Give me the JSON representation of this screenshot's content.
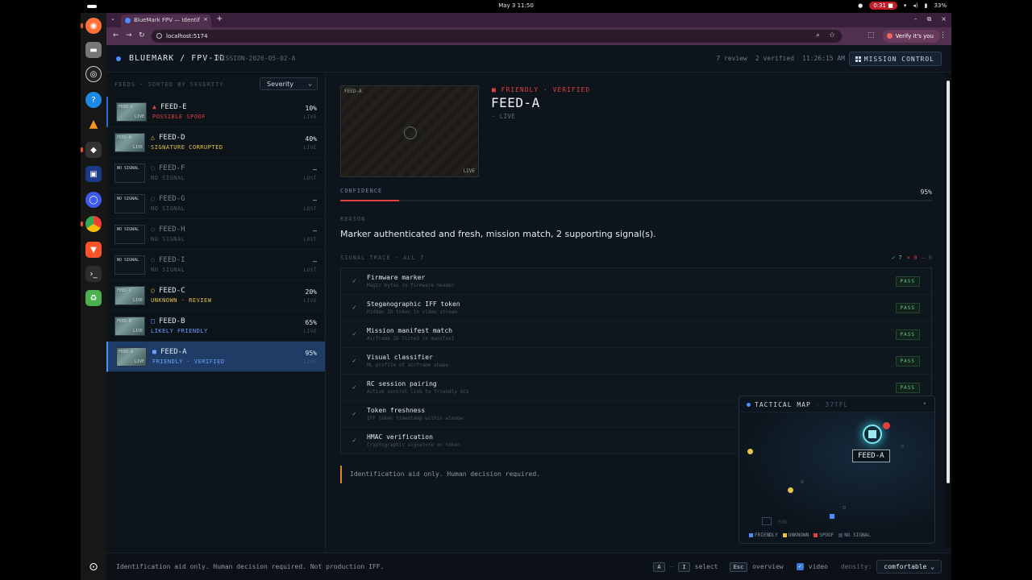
{
  "system": {
    "clock": "May 3  11:50",
    "record_time": "0:31",
    "battery": "33%"
  },
  "browser": {
    "tab_title": "BlueMark FPV — Identif",
    "url": "localhost:5174",
    "verify_label": "Verify it's you"
  },
  "header": {
    "brand": "BLUEMARK / FPV-ID",
    "mission": "MISSION-2026-05-02-A",
    "review": "7 review",
    "verified": "2 verified",
    "time": "11:26:15 AM",
    "mission_control": "MISSION CONTROL"
  },
  "sidebar": {
    "label": "FEEDS · SORTED BY SEVERITY",
    "sort_value": "Severity",
    "feeds": [
      {
        "name": "FEED-E",
        "icon": "▲",
        "icon_color": "#e0413f",
        "status": "POSSIBLE SPOOF",
        "status_color": "#e0413f",
        "pct": "10%",
        "state": "LIVE",
        "live": true,
        "thumb_tl": "FEED-E",
        "thumb_br": "LIVE"
      },
      {
        "name": "FEED-D",
        "icon": "△",
        "icon_color": "#e6c34a",
        "status": "SIGNATURE CORRUPTED",
        "status_color": "#e6c34a",
        "pct": "40%",
        "state": "LIVE",
        "live": true,
        "thumb_tl": "FEED-D",
        "thumb_br": "LIVE"
      },
      {
        "name": "FEED-F",
        "icon": "○",
        "icon_color": "#4a5866",
        "status": "NO SIGNAL",
        "status_color": "#4a5866",
        "pct": "—",
        "state": "LOST",
        "live": false,
        "thumb_tl": "NO SIGNAL",
        "thumb_br": ""
      },
      {
        "name": "FEED-G",
        "icon": "○",
        "icon_color": "#4a5866",
        "status": "NO SIGNAL",
        "status_color": "#4a5866",
        "pct": "—",
        "state": "LOST",
        "live": false,
        "thumb_tl": "NO SIGNAL",
        "thumb_br": ""
      },
      {
        "name": "FEED-H",
        "icon": "○",
        "icon_color": "#4a5866",
        "status": "NO SIGNAL",
        "status_color": "#4a5866",
        "pct": "—",
        "state": "LOST",
        "live": false,
        "thumb_tl": "NO SIGNAL",
        "thumb_br": ""
      },
      {
        "name": "FEED-I",
        "icon": "○",
        "icon_color": "#4a5866",
        "status": "NO SIGNAL",
        "status_color": "#4a5866",
        "pct": "—",
        "state": "LOST",
        "live": false,
        "thumb_tl": "NO SIGNAL",
        "thumb_br": ""
      },
      {
        "name": "FEED-C",
        "icon": "○",
        "icon_color": "#e6c34a",
        "status": "UNKNOWN · REVIEW",
        "status_color": "#e6c34a",
        "pct": "20%",
        "state": "LIVE",
        "live": true,
        "thumb_tl": "FEED-C",
        "thumb_br": "LIVE"
      },
      {
        "name": "FEED-B",
        "icon": "□",
        "icon_color": "#6ea0ff",
        "status": "LIKELY FRIENDLY",
        "status_color": "#6ea0ff",
        "pct": "65%",
        "state": "LIVE",
        "live": true,
        "thumb_tl": "FEED-B",
        "thumb_br": "LIVE"
      },
      {
        "name": "FEED-A",
        "icon": "■",
        "icon_color": "#6ea0ff",
        "status": "FRIENDLY · VERIFIED",
        "status_color": "#6ea0ff",
        "pct": "95%",
        "state": "LIVE",
        "live": true,
        "thumb_tl": "FEED-A",
        "thumb_br": "LIVE"
      }
    ]
  },
  "detail": {
    "video_label": "FEED-A",
    "video_state": "LIVE",
    "badge": "FRIENDLY · VERIFIED",
    "title": "FEED-A",
    "subtitle": "· LIVE",
    "confidence_label": "CONFIDENCE",
    "confidence_value": "95%",
    "confidence_fraction": 0.1,
    "reason_label": "REASON",
    "reason": "Marker authenticated and fresh, mission match, 2 supporting signal(s).",
    "trace_label": "SIGNAL TRACE · ALL 7",
    "counts": {
      "pass": "✓ 7",
      "fail": "× 0",
      "other": "– 0"
    },
    "trace": [
      {
        "name": "Firmware marker",
        "desc": "Magic bytes in firmware header",
        "result": "PASS"
      },
      {
        "name": "Steganographic IFF token",
        "desc": "Hidden ID token in video stream",
        "result": "PASS"
      },
      {
        "name": "Mission manifest match",
        "desc": "Airframe ID listed in manifest",
        "result": "PASS"
      },
      {
        "name": "Visual classifier",
        "desc": "ML profile of airframe shape",
        "result": "PASS"
      },
      {
        "name": "RC session pairing",
        "desc": "Active control link to friendly GCS",
        "result": "PASS"
      },
      {
        "name": "Token freshness",
        "desc": "IFF token timestamp within window",
        "result": ""
      },
      {
        "name": "HMAC verification",
        "desc": "Cryptographic signature on token",
        "result": ""
      }
    ],
    "note": "Identification aid only. Human decision required."
  },
  "map": {
    "title": "TACTICAL MAP",
    "subtitle": "· 37TFL",
    "selected_label": "FEED-A",
    "fob_label": "FOB",
    "legend": [
      {
        "label": "FRIENDLY",
        "color": "#4c8dff"
      },
      {
        "label": "UNKNOWN",
        "color": "#e6c34a"
      },
      {
        "label": "SPOOF",
        "color": "#e0413f"
      },
      {
        "label": "NO SIGNAL",
        "color": "#3a4654"
      }
    ]
  },
  "footer": {
    "disclaimer": "Identification aid only. Human decision required. Not production IFF.",
    "key_a": "A",
    "key_i": "I",
    "select_label": "select",
    "key_esc": "Esc",
    "overview_label": "overview",
    "video_label": "video",
    "density_label": "density:",
    "density_value": "comfortable"
  }
}
